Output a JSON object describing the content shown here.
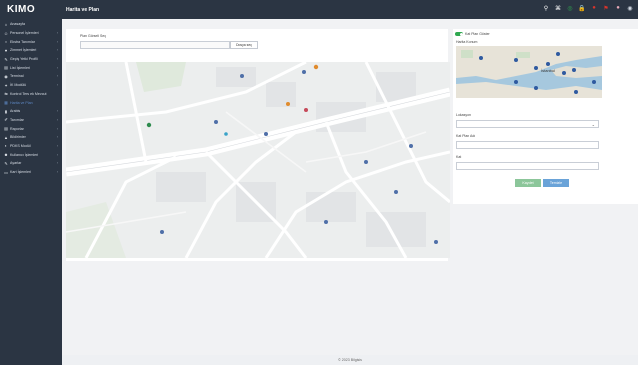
{
  "app": {
    "logo": "KIMO",
    "page_title": "Harita ve Plan"
  },
  "sidebar": {
    "items": [
      {
        "label": "Anasayfa",
        "icon": "home-icon",
        "glyph": "⌂",
        "chevron": ""
      },
      {
        "label": "Personel İşlemleri",
        "icon": "users-icon",
        "glyph": "☺",
        "chevron": "‹"
      },
      {
        "label": "Ekstra Tanımlar",
        "icon": "circle-icon",
        "glyph": "○",
        "chevron": "‹"
      },
      {
        "label": "Zimmet İşlemleri",
        "icon": "heart-icon",
        "glyph": "♥",
        "chevron": "‹"
      },
      {
        "label": "Geçiş Yetki Profili",
        "icon": "key-icon",
        "glyph": "✎",
        "chevron": "‹"
      },
      {
        "label": "List İşlemleri",
        "icon": "list-icon",
        "glyph": "▤",
        "chevron": "‹"
      },
      {
        "label": "Terminal",
        "icon": "terminal-icon",
        "glyph": "◉",
        "chevron": "‹"
      },
      {
        "label": "İK Modülü",
        "icon": "hr-icon",
        "glyph": "✦",
        "chevron": "‹"
      },
      {
        "label": "Kontrol Ters ek Mevcut",
        "icon": "control-icon",
        "glyph": "⇆",
        "chevron": ""
      },
      {
        "label": "Harita ve Plan",
        "icon": "map-icon",
        "glyph": "▦",
        "chevron": ""
      },
      {
        "label": "Arabis",
        "icon": "chart-icon",
        "glyph": "▮",
        "chevron": "‹"
      },
      {
        "label": "Tanımlar",
        "icon": "pen-icon",
        "glyph": "✐",
        "chevron": "‹"
      },
      {
        "label": "Raporlar",
        "icon": "file-icon",
        "glyph": "▤",
        "chevron": "‹"
      },
      {
        "label": "Bildirimler",
        "icon": "bell-icon",
        "glyph": "▲",
        "chevron": "‹"
      },
      {
        "label": "PDKS Modül",
        "icon": "pdks-icon",
        "glyph": "◐",
        "chevron": "‹"
      },
      {
        "label": "Kullanıcı İşlemleri",
        "icon": "user-icon",
        "glyph": "☻",
        "chevron": "‹"
      },
      {
        "label": "Ayarlar",
        "icon": "gear-icon",
        "glyph": "✎",
        "chevron": "‹"
      },
      {
        "label": "Kart İşlemleri",
        "icon": "card-icon",
        "glyph": "▭",
        "chevron": "‹"
      }
    ]
  },
  "topbar": {
    "icons": [
      {
        "name": "search-icon",
        "glyph": "⚲",
        "color": "#ffffff"
      },
      {
        "name": "grid-icon",
        "glyph": "⌘",
        "color": "#ffffff"
      },
      {
        "name": "status-icon",
        "glyph": "◎",
        "color": "#2fa84f"
      },
      {
        "name": "lock-icon",
        "glyph": "🔒",
        "color": "#2fa84f"
      },
      {
        "name": "alert-icon",
        "glyph": "●",
        "color": "#d9342b"
      },
      {
        "name": "flag-icon",
        "glyph": "⚑",
        "color": "#d9342b"
      },
      {
        "name": "profile-icon",
        "glyph": "●",
        "color": "#e8a9b8"
      },
      {
        "name": "avatar-icon",
        "glyph": "◉",
        "color": "#cfd6df"
      }
    ]
  },
  "upload": {
    "label": "Plan Görseli Seç",
    "button": "Dosya seç"
  },
  "right_panel": {
    "toggle_label": "Kat Plan Göster",
    "map_label": "Harita Konum",
    "map_city": "İstanbul",
    "location_label": "Lokasyon",
    "plan_name_label": "Kat Plan Adı",
    "floor_label": "Kat",
    "save_button": "Kaydet",
    "clear_button": "Temizle",
    "select_arrow": "⌄"
  },
  "footer": {
    "text": "© 2023 Bilgisis"
  },
  "colors": {
    "sidebar_bg": "#2b3543",
    "accent_green": "#2fa84f",
    "accent_blue": "#6aa3d8",
    "map_bg": "#eceeee"
  }
}
